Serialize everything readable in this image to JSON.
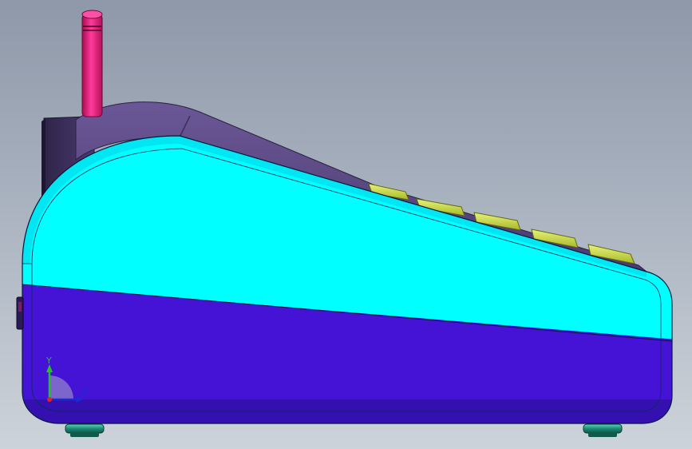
{
  "viewport": {
    "background_top": "#8e98a8",
    "background_bottom": "#cdd3da"
  },
  "model": {
    "upper_shell_color": "#00ffff",
    "lower_shell_color": "#4413d6",
    "top_cover_color": "#5f4a86",
    "antenna_color": "#e8197a",
    "key_color": "#c2d63a",
    "foot_color": "#2a9b86"
  },
  "triad": {
    "y_label": "Y",
    "z_label": "Z",
    "y_axis_color": "#22c322",
    "z_axis_color": "#1a2bd6",
    "x_axis_color": "#e0202a"
  }
}
